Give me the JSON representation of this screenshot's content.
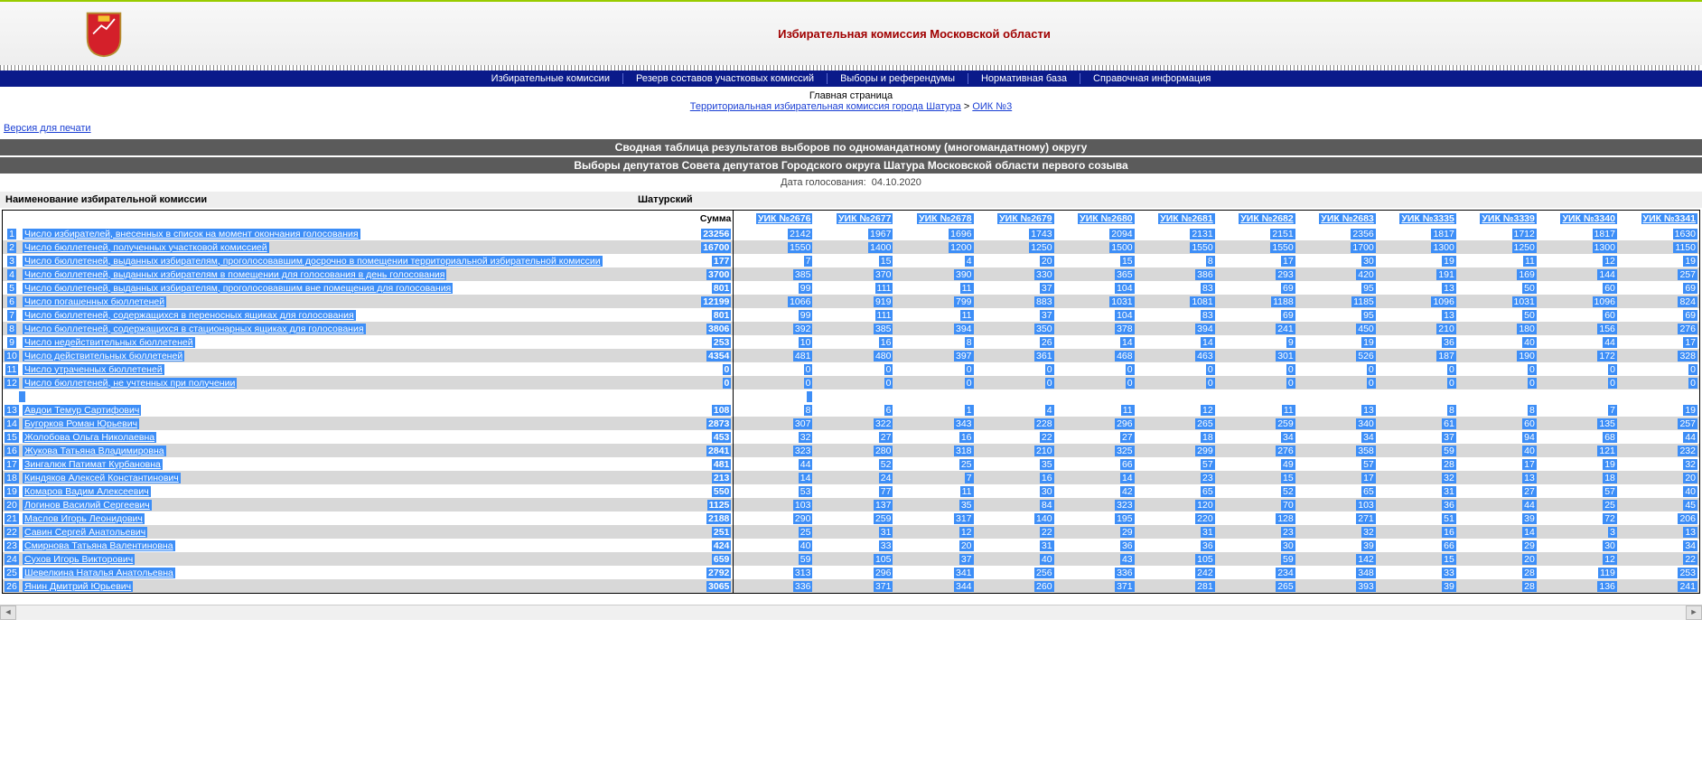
{
  "header": {
    "title": "Избирательная комиссия Московской области"
  },
  "menu": [
    "Избирательные комиссии",
    "Резерв составов участковых комиссий",
    "Выборы и референдумы",
    "Нормативная база",
    "Справочная информация"
  ],
  "breadcrumb": {
    "home": "Главная страница",
    "link1": "Территориальная избирательная комиссия города Шатура",
    "link2": "ОИК №3"
  },
  "print_link": "Версия для печати",
  "bar1": "Сводная таблица результатов выборов по одномандатному (многомандатному) округу",
  "bar2": "Выборы депутатов Совета депутатов Городского округа Шатура Московской области первого созыва",
  "vote_date_label": "Дата голосования:",
  "vote_date": "04.10.2020",
  "comm_label": "Наименование избирательной комиссии",
  "comm_name": "Шатурский",
  "sum_label": "Сумма",
  "uiks": [
    "УИК №2676",
    "УИК №2677",
    "УИК №2678",
    "УИК №2679",
    "УИК №2680",
    "УИК №2681",
    "УИК №2682",
    "УИК №2683",
    "УИК №3335",
    "УИК №3339",
    "УИК №3340",
    "УИК №3341"
  ],
  "rows": [
    {
      "n": "1",
      "label": "Число избирателей, внесенных в список на момент окончания голосования",
      "sum": "23256",
      "v": [
        "2142",
        "1967",
        "1696",
        "1743",
        "2094",
        "2131",
        "2151",
        "2356",
        "1817",
        "1712",
        "1817",
        "1630"
      ]
    },
    {
      "n": "2",
      "label": "Число бюллетеней, полученных участковой комиссией",
      "sum": "16700",
      "v": [
        "1550",
        "1400",
        "1200",
        "1250",
        "1500",
        "1550",
        "1550",
        "1700",
        "1300",
        "1250",
        "1300",
        "1150"
      ]
    },
    {
      "n": "3",
      "label": "Число бюллетеней, выданных избирателям, проголосовавшим досрочно в помещении территориальной избирательной комиссии",
      "sum": "177",
      "v": [
        "7",
        "15",
        "4",
        "20",
        "15",
        "8",
        "17",
        "30",
        "19",
        "11",
        "12",
        "19"
      ]
    },
    {
      "n": "4",
      "label": "Число бюллетеней, выданных избирателям в помещении для голосования в день голосования",
      "sum": "3700",
      "v": [
        "385",
        "370",
        "390",
        "330",
        "365",
        "386",
        "293",
        "420",
        "191",
        "169",
        "144",
        "257"
      ]
    },
    {
      "n": "5",
      "label": "Число бюллетеней, выданных избирателям, проголосовавшим вне помещения для голосования",
      "sum": "801",
      "v": [
        "99",
        "111",
        "11",
        "37",
        "104",
        "83",
        "69",
        "95",
        "13",
        "50",
        "60",
        "69"
      ]
    },
    {
      "n": "6",
      "label": "Число погашенных бюллетеней",
      "sum": "12199",
      "v": [
        "1066",
        "919",
        "799",
        "883",
        "1031",
        "1081",
        "1188",
        "1185",
        "1096",
        "1031",
        "1096",
        "824"
      ]
    },
    {
      "n": "7",
      "label": "Число бюллетеней, содержащихся в переносных ящиках для голосования",
      "sum": "801",
      "v": [
        "99",
        "111",
        "11",
        "37",
        "104",
        "83",
        "69",
        "95",
        "13",
        "50",
        "60",
        "69"
      ]
    },
    {
      "n": "8",
      "label": "Число бюллетеней, содержащихся в стационарных ящиках для голосования",
      "sum": "3806",
      "v": [
        "392",
        "385",
        "394",
        "350",
        "378",
        "394",
        "241",
        "450",
        "210",
        "180",
        "156",
        "276"
      ]
    },
    {
      "n": "9",
      "label": "Число недействительных бюллетеней",
      "sum": "253",
      "v": [
        "10",
        "16",
        "8",
        "26",
        "14",
        "14",
        "9",
        "19",
        "36",
        "40",
        "44",
        "17"
      ]
    },
    {
      "n": "10",
      "label": "Число действительных бюллетеней",
      "sum": "4354",
      "v": [
        "481",
        "480",
        "397",
        "361",
        "468",
        "463",
        "301",
        "526",
        "187",
        "190",
        "172",
        "328"
      ]
    },
    {
      "n": "11",
      "label": "Число утраченных бюллетеней",
      "sum": "0",
      "v": [
        "0",
        "0",
        "0",
        "0",
        "0",
        "0",
        "0",
        "0",
        "0",
        "0",
        "0",
        "0"
      ]
    },
    {
      "n": "12",
      "label": "Число бюллетеней, не учтенных при получении",
      "sum": "0",
      "v": [
        "0",
        "0",
        "0",
        "0",
        "0",
        "0",
        "0",
        "0",
        "0",
        "0",
        "0",
        "0"
      ]
    }
  ],
  "cands": [
    {
      "n": "13",
      "label": "Авдои Темур Сартифович",
      "sum": "108",
      "v": [
        "8",
        "6",
        "1",
        "4",
        "11",
        "12",
        "11",
        "13",
        "8",
        "8",
        "7",
        "19"
      ]
    },
    {
      "n": "14",
      "label": "Бугорков Роман Юрьевич",
      "sum": "2873",
      "v": [
        "307",
        "322",
        "343",
        "228",
        "296",
        "265",
        "259",
        "340",
        "61",
        "60",
        "135",
        "257"
      ]
    },
    {
      "n": "15",
      "label": "Жолобова Ольга Николаевна",
      "sum": "453",
      "v": [
        "32",
        "27",
        "16",
        "22",
        "27",
        "18",
        "34",
        "34",
        "37",
        "94",
        "68",
        "44"
      ]
    },
    {
      "n": "16",
      "label": "Жукова Татьяна Владимировна",
      "sum": "2841",
      "v": [
        "323",
        "280",
        "318",
        "210",
        "325",
        "299",
        "276",
        "358",
        "59",
        "40",
        "121",
        "232"
      ]
    },
    {
      "n": "17",
      "label": "Зингалюк Патимат Курбановна",
      "sum": "481",
      "v": [
        "44",
        "52",
        "25",
        "35",
        "66",
        "57",
        "49",
        "57",
        "28",
        "17",
        "19",
        "32"
      ]
    },
    {
      "n": "18",
      "label": "Киндяков Алексей Константинович",
      "sum": "213",
      "v": [
        "14",
        "24",
        "7",
        "16",
        "14",
        "23",
        "15",
        "17",
        "32",
        "13",
        "18",
        "20"
      ]
    },
    {
      "n": "19",
      "label": "Комаров Вадим Алексеевич",
      "sum": "550",
      "v": [
        "53",
        "77",
        "11",
        "30",
        "42",
        "65",
        "52",
        "65",
        "31",
        "27",
        "57",
        "40"
      ]
    },
    {
      "n": "20",
      "label": "Логинов Василий Сергеевич",
      "sum": "1125",
      "v": [
        "103",
        "137",
        "35",
        "84",
        "323",
        "120",
        "70",
        "103",
        "36",
        "44",
        "25",
        "45"
      ]
    },
    {
      "n": "21",
      "label": "Маслов Игорь Леонидович",
      "sum": "2188",
      "v": [
        "290",
        "259",
        "317",
        "140",
        "195",
        "220",
        "128",
        "271",
        "51",
        "39",
        "72",
        "206"
      ]
    },
    {
      "n": "22",
      "label": "Савин Сергей Анатольевич",
      "sum": "251",
      "v": [
        "25",
        "31",
        "12",
        "22",
        "29",
        "31",
        "23",
        "32",
        "16",
        "14",
        "3",
        "13"
      ]
    },
    {
      "n": "23",
      "label": "Смирнова Татьяна Валентиновна",
      "sum": "424",
      "v": [
        "40",
        "33",
        "20",
        "31",
        "36",
        "36",
        "30",
        "39",
        "66",
        "29",
        "30",
        "34"
      ]
    },
    {
      "n": "24",
      "label": "Сухов Игорь Викторович",
      "sum": "659",
      "v": [
        "59",
        "105",
        "37",
        "40",
        "43",
        "105",
        "59",
        "142",
        "15",
        "20",
        "12",
        "22"
      ]
    },
    {
      "n": "25",
      "label": "Шевелкина Наталья Анатольевна",
      "sum": "2792",
      "v": [
        "313",
        "296",
        "341",
        "256",
        "336",
        "242",
        "234",
        "348",
        "33",
        "28",
        "119",
        "253"
      ]
    },
    {
      "n": "26",
      "label": "Янин Дмитрий Юрьевич",
      "sum": "3065",
      "v": [
        "336",
        "371",
        "344",
        "260",
        "371",
        "281",
        "265",
        "393",
        "39",
        "28",
        "136",
        "241"
      ]
    }
  ]
}
